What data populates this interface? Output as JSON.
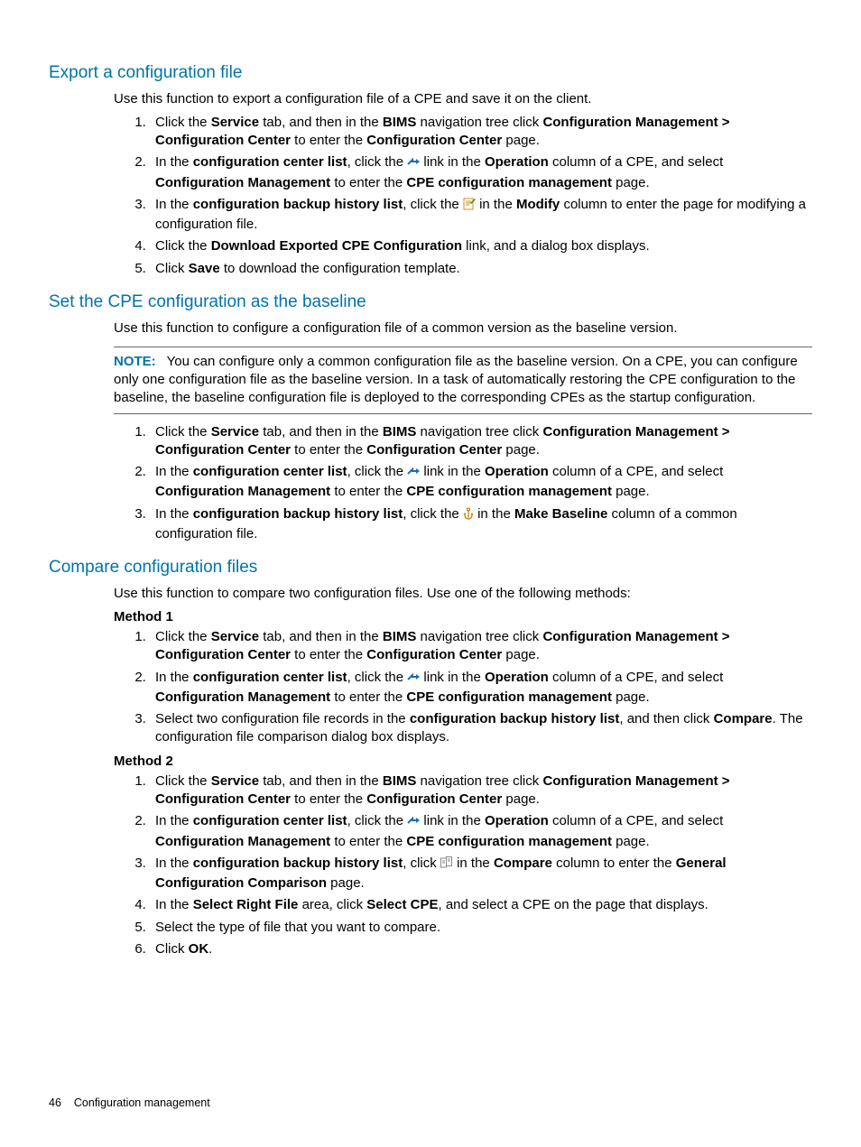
{
  "section1": {
    "title": "Export a configuration file",
    "intro": "Use this function to export a configuration file of a CPE and save it on the client.",
    "steps": [
      "Click the <b>Service</b> tab, and then in the <b>BIMS</b> navigation tree click <b>Configuration Management > Configuration Center</b> to enter the <b>Configuration Center</b> page.",
      "In the <b>configuration center list</b>, click the {arrow} link in the <b>Operation</b> column of a CPE, and select <b>Configuration Management</b> to enter the <b>CPE configuration management</b> page.",
      "In the <b>configuration backup history list</b>, click the {edit} in the <b>Modify</b> column to enter the page for modifying a configuration file.",
      "Click the <b>Download Exported CPE Configuration</b> link, and a dialog box displays.",
      "Click <b>Save</b> to download the configuration template."
    ]
  },
  "section2": {
    "title": "Set the CPE configuration as the baseline",
    "intro": "Use this function to configure a configuration file of a common version as the baseline version.",
    "note_label": "NOTE:",
    "note": "You can configure only a common configuration file as the baseline version. On a CPE, you can configure only one configuration file as the baseline version. In a task of automatically restoring the CPE configuration to the baseline, the baseline configuration file is deployed to the corresponding CPEs as the startup configuration.",
    "steps": [
      "Click the <b>Service</b> tab, and then in the <b>BIMS</b> navigation tree click <b>Configuration Management > Configuration Center</b> to enter the <b>Configuration Center</b> page.",
      "In the <b>configuration center list</b>, click the {arrow} link in the <b>Operation</b> column of a CPE, and select <b>Configuration Management</b> to enter the <b>CPE configuration management</b> page.",
      "In the <b>configuration backup history list</b>, click the {anchor} in the <b>Make Baseline</b> column of a common configuration file."
    ]
  },
  "section3": {
    "title": "Compare configuration files",
    "intro": "Use this function to compare two configuration files. Use one of the following methods:",
    "method1_label": "Method 1",
    "method1_steps": [
      "Click the <b>Service</b> tab, and then in the <b>BIMS</b> navigation tree click <b>Configuration Management > Configuration Center</b> to enter the <b>Configuration Center</b> page.",
      "In the <b>configuration center list</b>, click the {arrow} link in the <b>Operation</b> column of a CPE, and select <b>Configuration Management</b> to enter the <b>CPE configuration management</b> page.",
      "Select two configuration file records in the <b>configuration backup history list</b>, and then click <b>Compare</b>. The configuration file comparison dialog box displays."
    ],
    "method2_label": "Method 2",
    "method2_steps": [
      "Click the <b>Service</b> tab, and then in the <b>BIMS</b> navigation tree click <b>Configuration Management > Configuration Center</b> to enter the <b>Configuration Center</b> page.",
      "In the <b>configuration center list</b>, click the {arrow} link in the <b>Operation</b> column of a CPE, and select <b>Configuration Management</b> to enter the <b>CPE configuration management</b> page.",
      "In the <b>configuration backup history list</b>, click {compare} in the <b>Compare</b> column to enter the <b>General Configuration Comparison</b> page.",
      "In the <b>Select Right File</b> area, click <b>Select CPE</b>, and select a CPE on the page that displays.",
      "Select the type of file that you want to compare.",
      "Click <b>OK</b>."
    ]
  },
  "footer": {
    "page": "46",
    "chapter": "Configuration management"
  },
  "icons": {
    "arrow": "<svg width='14' height='12' viewBox='0 0 14 12'><path d='M1 8 L6 3 L6 5 L13 5' stroke='#1a6fb0' stroke-width='2' fill='none'/><path d='M10 2 L14 5 L10 8 Z' fill='#1a6fb0'/></svg>",
    "edit": "<svg width='14' height='14' viewBox='0 0 14 14'><rect x='1' y='1' width='10' height='12' fill='#fff' stroke='#d09020'/><path d='M3 4h6M3 6h6M3 8h4' stroke='#d09020'/><path d='M8 6 L13 1 L14 2 L9 7 Z' fill='#2a8a2a'/></svg>",
    "anchor": "<svg width='12' height='14' viewBox='0 0 12 14'><circle cx='6' cy='2.5' r='1.5' fill='none' stroke='#c97e00' stroke-width='1.2'/><path d='M6 4 V12 M2 8 Q2 13 6 13 Q10 13 10 8 M1 8 L2 7 L3 8 M11 8 L10 7 L9 8' stroke='#c97e00' stroke-width='1.2' fill='none'/></svg>",
    "compare": "<svg width='14' height='14' viewBox='0 0 14 14'><rect x='0.5' y='2' width='6' height='10' fill='#fff' stroke='#888'/><rect x='6.5' y='0.5' width='6' height='10' fill='#fff' stroke='#888'/><path d='M2 5h3M2 7h3M8 3h3M8 5h3' stroke='#888'/></svg>"
  }
}
